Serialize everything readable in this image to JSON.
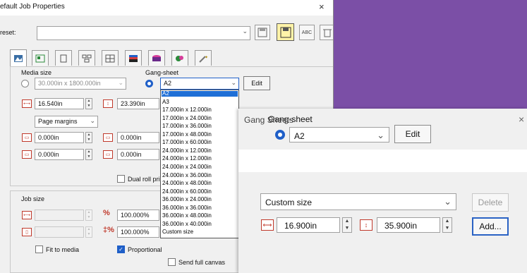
{
  "main_window": {
    "title": "efault Job Properties",
    "close_glyph": "×",
    "preset_label": "reset:",
    "preset_value": "",
    "toolbar_abc": "ABC",
    "media_size_label": "Media size",
    "media_size_value": "30.000in x 1800.000in",
    "gang_sheet_label": "Gang-sheet",
    "gang_sheet_value": "A2",
    "edit_label": "Edit",
    "width_value": "16.540in",
    "height_value": "23.390in",
    "margins_select": "Page margins",
    "margin_top_left": "0.000in",
    "margin_top_right": "0.000in",
    "margin_bottom_left": "0.000in",
    "margin_bottom_right": "0.000in",
    "dual_roll_label": "Dual roll pri",
    "job_size_label": "Job size",
    "job_width": "",
    "job_height": "",
    "percent_w": "100.000%",
    "percent_h": "100.000%",
    "fit_to_media_label": "Fit to media",
    "proportional_label": "Proportional",
    "send_full_canvas_label": "Send full canvas"
  },
  "dropdown": {
    "items": [
      "A2",
      "A3",
      "17.000in x 12.000in",
      "17.000in x 24.000in",
      "17.000in x 36.000in",
      "17.000in x 48.000in",
      "17.000in x 60.000in",
      "24.000in x 12.000in",
      "24.000in x 12.000in",
      "24.000in x 24.000in",
      "24.000in x 36.000in",
      "24.000in x 48.000in",
      "24.000in x 60.000in",
      "36.000in x 24.000in",
      "36.000in x 36.000in",
      "36.000in x 48.000in",
      "36.000in x 40.000in",
      "Custom size"
    ],
    "selected_index": 0
  },
  "gang_window": {
    "gang_sheet_label": "Gang-sheet",
    "gang_sheet_value": "A2",
    "edit_label": "Edit",
    "title": "Gang Sheets",
    "close_glyph": "×",
    "size_select": "Custom size",
    "delete_label": "Delete",
    "width_value": "16.900in",
    "height_value": "35.900in",
    "add_label": "Add..."
  },
  "icons": {
    "chevron": "⌄",
    "spin_up": "▲",
    "spin_down": "▼",
    "check": "✓"
  },
  "colors": {
    "background": "#7b4fa6",
    "selection": "#1f6fd6",
    "accent": "#1f5fc8"
  }
}
